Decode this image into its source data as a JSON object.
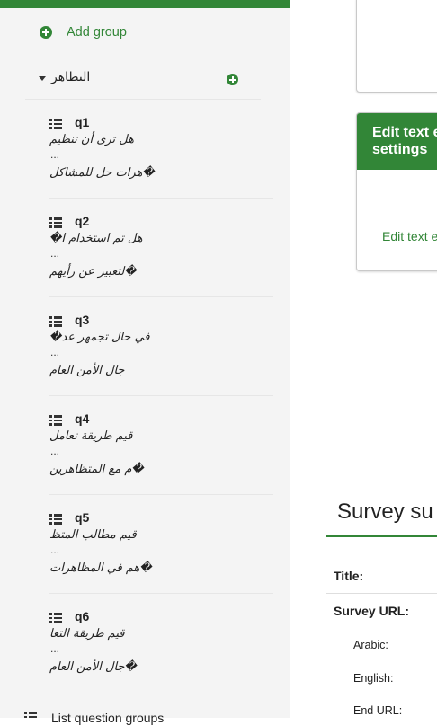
{
  "sidebar": {
    "add_group_label": "Add group",
    "group": {
      "title": "التظاهر"
    },
    "questions": [
      {
        "code": "q1",
        "line1": "هل ترى أن تنظيم",
        "dots": "...",
        "line2": "هرات حل للمشاكل�"
      },
      {
        "code": "q2",
        "line1": "�هل تم استخدام ا",
        "dots": "...",
        "line2": "لتعبير عن رأيهم�"
      },
      {
        "code": "q3",
        "line1": "�في حال تجمهر عد",
        "dots": "...",
        "line2": "جال الأمن العام"
      },
      {
        "code": "q4",
        "line1": "قيم طريقة تعامل",
        "dots": "...",
        "line2": "م مع المتظاهرين�"
      },
      {
        "code": "q5",
        "line1": "قيم مطالب المتظ",
        "dots": "...",
        "line2": "هم في المظاهرات�"
      },
      {
        "code": "q6",
        "line1": "قيم طريقة التعا",
        "dots": "...",
        "line2": "جال الأمن العام�"
      }
    ],
    "list_groups_label": "List question groups"
  },
  "main": {
    "edit_text_card": {
      "title": "Edit text e\nsettings",
      "link": "Edit text e"
    },
    "summary": {
      "title": "Survey su",
      "title_label": "Title:",
      "url_label": "Survey URL:",
      "arabic_label": "Arabic:",
      "english_label": "English:",
      "end_url_label": "End URL:"
    }
  },
  "colors": {
    "accent": "#328637",
    "sidebar_bg": "#f4f4f4"
  }
}
